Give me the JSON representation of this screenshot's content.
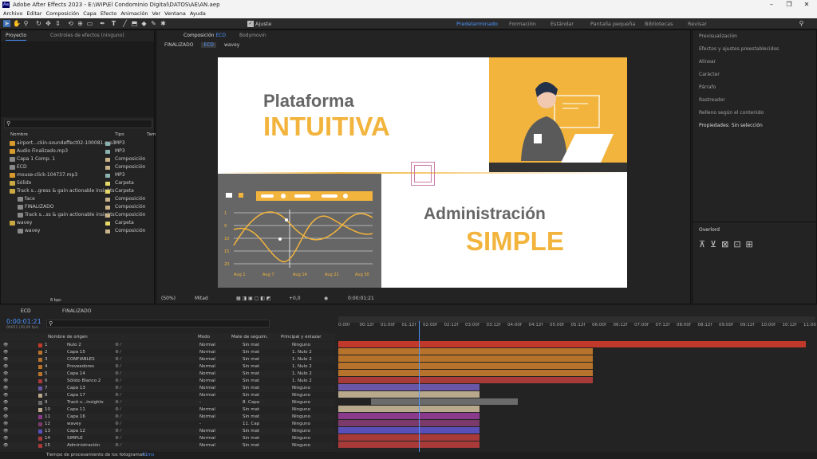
{
  "window": {
    "title": "Adobe After Effects 2023 - E:\\WIP\\El Condominio Digital\\DATOS\\AE\\AN.aep",
    "logo": "Ae"
  },
  "menu": [
    "Archivo",
    "Editar",
    "Composición",
    "Capa",
    "Efecto",
    "Animación",
    "Ver",
    "Ventana",
    "Ayuda"
  ],
  "toolbar": {
    "ajuste": "Ajuste",
    "workspaces": [
      "Predeterminado",
      "Formación",
      "Estándar",
      "Pantalla pequeña",
      "Bibliotecas",
      "Revisar"
    ],
    "active_workspace": "Predeterminado"
  },
  "project": {
    "tab_project": "Proyecto",
    "tab_effects": "Controles de efectos (ninguno)",
    "col_name": "Nombre",
    "col_type": "Tipo",
    "col_size": "Tam",
    "bpc": "8 bpc",
    "items": [
      {
        "name": "airport...ckin-soundeffect02-100081.mp3",
        "type": "MP3",
        "color": "#8ab3b0",
        "icon": "audio-file-icon"
      },
      {
        "name": "Audio Finalizado.mp3",
        "type": "MP3",
        "color": "#8ab3b0",
        "icon": "audio-file-icon"
      },
      {
        "name": "Capa 1 Comp. 1",
        "type": "Composición",
        "color": "#c8b38a",
        "icon": "composition-icon"
      },
      {
        "name": "ECD",
        "type": "Composición",
        "color": "#c8b38a",
        "icon": "composition-icon"
      },
      {
        "name": "mouse-click-104737.mp3",
        "type": "MP3",
        "color": "#8ab3b0",
        "icon": "audio-file-icon"
      },
      {
        "name": "Sólido",
        "type": "Carpeta",
        "color": "#e5d86a",
        "icon": "folder-icon"
      },
      {
        "name": "Track s...gress & gain actionable insights",
        "type": "Carpeta",
        "color": "#e5d86a",
        "icon": "folder-icon"
      },
      {
        "name": "face",
        "type": "Composición",
        "color": "#c8b38a",
        "icon": "composition-icon",
        "indent": 1
      },
      {
        "name": "FINALIZADO",
        "type": "Composición",
        "color": "#c8b38a",
        "icon": "composition-icon",
        "indent": 1
      },
      {
        "name": "Track s...ss & gain actionable insights",
        "type": "Composición",
        "color": "#c8b38a",
        "icon": "composition-icon",
        "indent": 1
      },
      {
        "name": "wavey",
        "type": "Carpeta",
        "color": "#e5d86a",
        "icon": "folder-icon"
      },
      {
        "name": "wavey",
        "type": "Composición",
        "color": "#c8b38a",
        "icon": "composition-icon",
        "indent": 1
      }
    ]
  },
  "composition": {
    "tab": "Composición",
    "tab_name": "ECD",
    "tab2": "Bodymovin",
    "breadcrumbs": [
      "FINALIZADO",
      "ECD",
      "wavey"
    ],
    "zoom": "(50%)",
    "resolution": "Mitad",
    "exposure": "+0,0",
    "timecode": "0:00:01:21",
    "slide": {
      "line1": "Plataforma",
      "line2": "INTUITIVA",
      "line3": "Administración",
      "line4": "SIMPLE",
      "axis": [
        "Aug 1",
        "Aug 7",
        "Aug 14",
        "Aug 21",
        "Aug 30"
      ],
      "y_ticks": [
        "1",
        "9",
        "10",
        "15",
        "20"
      ],
      "accent": "#f2b43c",
      "gray": "#666666"
    }
  },
  "right_panel": {
    "items": [
      "Previsualización",
      "Efectos y ajustes preestablecidos",
      "Alinear",
      "Carácter",
      "Párrafo",
      "Rastreador",
      "Relleno según el contenido"
    ],
    "properties": "Propiedades: Sin selección",
    "overlord": "Overlord"
  },
  "timeline": {
    "tab": "ECD",
    "tab2": "FINALIZADO",
    "timecode": "0:00:01:21",
    "fps": "00051 (30,00 fps)",
    "columns": {
      "name": "Nombre de origen",
      "mode": "Modo",
      "matte": "Mate de seguim.",
      "parent": "Principal y enlazar"
    },
    "ruler": [
      "0:00f",
      "00:12f",
      "01:00f",
      "01:12f",
      "02:00f",
      "02:12f",
      "03:00f",
      "03:12f",
      "04:00f",
      "04:12f",
      "05:00f",
      "05:12f",
      "06:00f",
      "06:12f",
      "07:00f",
      "07:12f",
      "08:00f",
      "08:12f",
      "09:00f",
      "09:12f",
      "10:00f",
      "10:12f",
      "11:00"
    ],
    "layers": [
      {
        "n": "1",
        "name": "Nulo 2",
        "mode": "Normal",
        "matte": "Sin mat",
        "parent": "Ninguno",
        "color": "#c0392b",
        "bar_start": 0,
        "bar_end": 1.0
      },
      {
        "n": "2",
        "name": "Capa 15",
        "mode": "Normal",
        "matte": "Sin mat",
        "parent": "1. Nulo 2",
        "color": "#b7732b",
        "bar_start": 0,
        "bar_end": 0.545
      },
      {
        "n": "3",
        "name": "CONFIABLES",
        "mode": "Normal",
        "matte": "Sin mat",
        "parent": "1. Nulo 2",
        "color": "#b7732b",
        "bar_start": 0,
        "bar_end": 0.545
      },
      {
        "n": "4",
        "name": "Proveedores",
        "mode": "Normal",
        "matte": "Sin mat",
        "parent": "1. Nulo 2",
        "color": "#b7732b",
        "bar_start": 0,
        "bar_end": 0.545
      },
      {
        "n": "5",
        "name": "Capa 14",
        "mode": "Normal",
        "matte": "Sin mat",
        "parent": "1. Nulo 2",
        "color": "#b7732b",
        "bar_start": 0,
        "bar_end": 0.545
      },
      {
        "n": "6",
        "name": "Sólido Blanco 2",
        "mode": "Normal",
        "matte": "Sin mat",
        "parent": "1. Nulo 2",
        "color": "#a83a3a",
        "bar_start": 0,
        "bar_end": 0.545
      },
      {
        "n": "7",
        "name": "Capa 13",
        "mode": "Normal",
        "matte": "Sin mat",
        "parent": "Ninguno",
        "color": "#6a57a8",
        "bar_start": 0,
        "bar_end": 0.302
      },
      {
        "n": "8",
        "name": "Capa 17",
        "mode": "Normal",
        "matte": "Sin mat",
        "parent": "Ninguno",
        "color": "#b9a98c",
        "bar_start": 0,
        "bar_end": 0.302
      },
      {
        "n": "9",
        "name": "Track s...insights",
        "mode": "-",
        "matte": "8. Capa",
        "parent": "Ninguno",
        "color": "#6b6b6b",
        "bar_start": 0.07,
        "bar_end": 0.384
      },
      {
        "n": "10",
        "name": "Capa 11",
        "mode": "Normal",
        "matte": "Sin mat",
        "parent": "Ninguno",
        "color": "#b9a98c",
        "bar_start": 0,
        "bar_end": 0.302
      },
      {
        "n": "11",
        "name": "Capa 16",
        "mode": "Normal",
        "matte": "Sin mat",
        "parent": "Ninguno",
        "color": "#8a3a8a",
        "bar_start": 0,
        "bar_end": 0.302
      },
      {
        "n": "12",
        "name": "wavey",
        "mode": "-",
        "matte": "11. Cap",
        "parent": "Ninguno",
        "color": "#7a3a6a",
        "bar_start": 0,
        "bar_end": 0.302
      },
      {
        "n": "13",
        "name": "Capa 12",
        "mode": "Normal",
        "matte": "Sin mat",
        "parent": "Ninguno",
        "color": "#5a4fb8",
        "bar_start": 0,
        "bar_end": 0.302
      },
      {
        "n": "14",
        "name": "SIMPLE",
        "mode": "Normal",
        "matte": "Sin mat",
        "parent": "Ninguno",
        "color": "#a83a3a",
        "bar_start": 0,
        "bar_end": 0.302
      },
      {
        "n": "15",
        "name": "Administración",
        "mode": "Normal",
        "matte": "Sin mat",
        "parent": "Ninguno",
        "color": "#a83a3a",
        "bar_start": 0,
        "bar_end": 0.302
      }
    ],
    "playhead": 0.172,
    "status_label": "Tiempo de procesamiento de los fotogramas:",
    "status_value": "31ms"
  }
}
